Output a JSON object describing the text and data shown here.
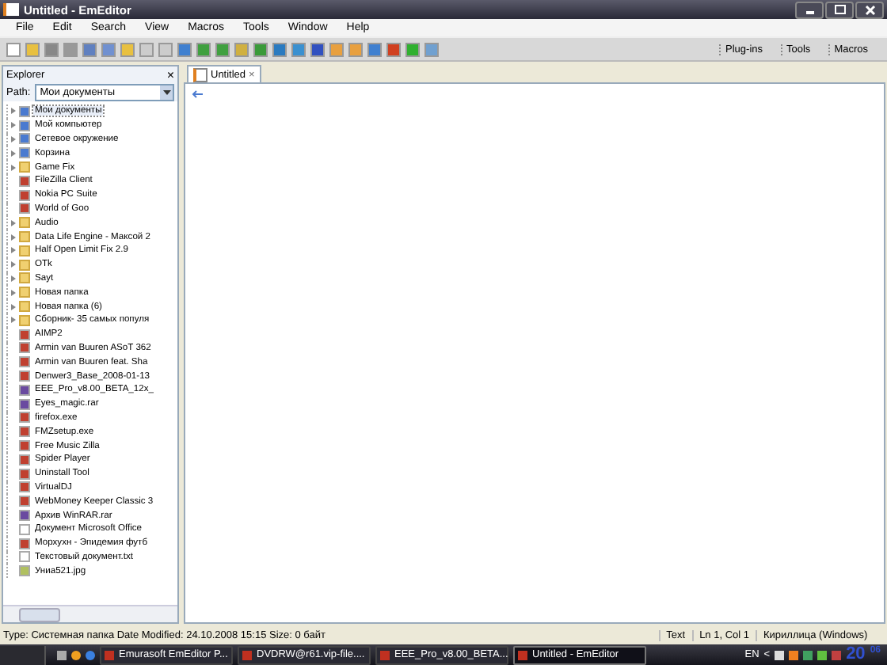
{
  "window": {
    "title": "Untitled - EmEditor"
  },
  "menu": [
    "File",
    "Edit",
    "Search",
    "View",
    "Macros",
    "Tools",
    "Window",
    "Help"
  ],
  "toolbar_bands": [
    "Plug-ins",
    "Tools",
    "Macros"
  ],
  "explorer": {
    "title": "Explorer",
    "close": "×",
    "path_label": "Path:",
    "path_value": "Мои документы",
    "items": [
      {
        "label": "Мои документы",
        "kind": "system",
        "expandable": true,
        "selected": true
      },
      {
        "label": "Мой компьютер",
        "kind": "system",
        "expandable": true,
        "selected": false
      },
      {
        "label": "Сетевое окружение",
        "kind": "system",
        "expandable": true,
        "selected": false
      },
      {
        "label": "Корзина",
        "kind": "system",
        "expandable": true,
        "selected": false
      },
      {
        "label": "Game Fix",
        "kind": "folder",
        "expandable": true,
        "selected": false
      },
      {
        "label": "FileZilla Client",
        "kind": "app",
        "expandable": false,
        "selected": false
      },
      {
        "label": "Nokia PC Suite",
        "kind": "app",
        "expandable": false,
        "selected": false
      },
      {
        "label": "World of Goo",
        "kind": "app",
        "expandable": false,
        "selected": false
      },
      {
        "label": "Audio",
        "kind": "folder",
        "expandable": true,
        "selected": false
      },
      {
        "label": "Data Life Engine - Максой 2",
        "kind": "folder",
        "expandable": true,
        "selected": false
      },
      {
        "label": "Half Open Limit Fix 2.9",
        "kind": "folder",
        "expandable": true,
        "selected": false
      },
      {
        "label": "OTk",
        "kind": "folder",
        "expandable": true,
        "selected": false
      },
      {
        "label": "Sayt",
        "kind": "folder",
        "expandable": true,
        "selected": false
      },
      {
        "label": "Новая папка",
        "kind": "folder",
        "expandable": true,
        "selected": false
      },
      {
        "label": "Новая папка (6)",
        "kind": "folder",
        "expandable": true,
        "selected": false
      },
      {
        "label": "Сборник- 35 самых популя",
        "kind": "folder",
        "expandable": true,
        "selected": false
      },
      {
        "label": "AIMP2",
        "kind": "app",
        "expandable": false,
        "selected": false
      },
      {
        "label": "Armin van Buuren ASoT 362",
        "kind": "app",
        "expandable": false,
        "selected": false
      },
      {
        "label": "Armin van Buuren feat. Sha",
        "kind": "app",
        "expandable": false,
        "selected": false
      },
      {
        "label": "Denwer3_Base_2008-01-13",
        "kind": "app",
        "expandable": false,
        "selected": false
      },
      {
        "label": "EEE_Pro_v8.00_BETA_12x_",
        "kind": "archive",
        "expandable": false,
        "selected": false
      },
      {
        "label": "Eyes_magic.rar",
        "kind": "archive",
        "expandable": false,
        "selected": false
      },
      {
        "label": "firefox.exe",
        "kind": "app",
        "expandable": false,
        "selected": false
      },
      {
        "label": "FMZsetup.exe",
        "kind": "app",
        "expandable": false,
        "selected": false
      },
      {
        "label": "Free Music Zilla",
        "kind": "app",
        "expandable": false,
        "selected": false
      },
      {
        "label": "Spider Player",
        "kind": "app",
        "expandable": false,
        "selected": false
      },
      {
        "label": "Uninstall Tool",
        "kind": "app",
        "expandable": false,
        "selected": false
      },
      {
        "label": "VirtualDJ",
        "kind": "app",
        "expandable": false,
        "selected": false
      },
      {
        "label": "WebMoney Keeper Classic 3",
        "kind": "app",
        "expandable": false,
        "selected": false
      },
      {
        "label": "Архив WinRAR.rar",
        "kind": "archive",
        "expandable": false,
        "selected": false
      },
      {
        "label": "Документ Microsoft Office",
        "kind": "file",
        "expandable": false,
        "selected": false
      },
      {
        "label": "Морхухн - Эпидемия футб",
        "kind": "app",
        "expandable": false,
        "selected": false
      },
      {
        "label": "Текстовый документ.txt",
        "kind": "file",
        "expandable": false,
        "selected": false
      },
      {
        "label": "Униа521.jpg",
        "kind": "image",
        "expandable": false,
        "selected": false
      }
    ]
  },
  "editor": {
    "tab": "Untitled",
    "tab_close": "×"
  },
  "status_bar": {
    "info": "Type: Системная папка Date Modified: 24.10.2008 15:15 Size: 0 байт",
    "mode": "Text",
    "position": "Ln 1, Col 1",
    "encoding": "Кириллица (Windows)"
  },
  "taskbar": {
    "buttons": [
      {
        "label": "Emurasoft EmEditor P...",
        "selected": false
      },
      {
        "label": "DVDRW@r61.vip-file....",
        "selected": false
      },
      {
        "label": "EEE_Pro_v8.00_BETA...",
        "selected": false
      },
      {
        "label": "Untitled - EmEditor",
        "selected": true
      }
    ],
    "language": "EN",
    "tray_toggle": "<",
    "clock_hours": "20",
    "clock_minutes": "06"
  }
}
